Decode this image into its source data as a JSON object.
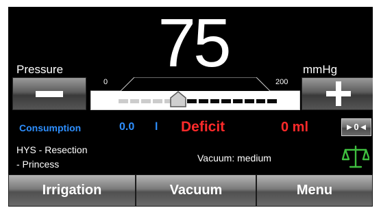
{
  "display": {
    "pressure_value": "75",
    "pressure_label": "Pressure",
    "unit": "mmHg"
  },
  "slider": {
    "min_label": "0",
    "max_label": "200",
    "min": 0,
    "max": 200,
    "value": 75
  },
  "buttons": {
    "decrease_icon": "minus-icon",
    "increase_icon": "plus-icon",
    "zero_label": "►0◄"
  },
  "consumption": {
    "label": "Consumption",
    "value": "0.0",
    "unit": "l"
  },
  "deficit": {
    "label": "Deficit",
    "value": "0 ml"
  },
  "procedure": {
    "line1": "HYS - Resection",
    "line2": "- Princess"
  },
  "vacuum_status": "Vacuum: medium",
  "status_icon": "balance-scale-icon",
  "nav": {
    "irrigation": "Irrigation",
    "vacuum": "Vacuum",
    "menu": "Menu"
  },
  "colors": {
    "consumption": "#2e8fff",
    "deficit": "#ff2a2a",
    "scale_icon": "#3fbf3f"
  }
}
